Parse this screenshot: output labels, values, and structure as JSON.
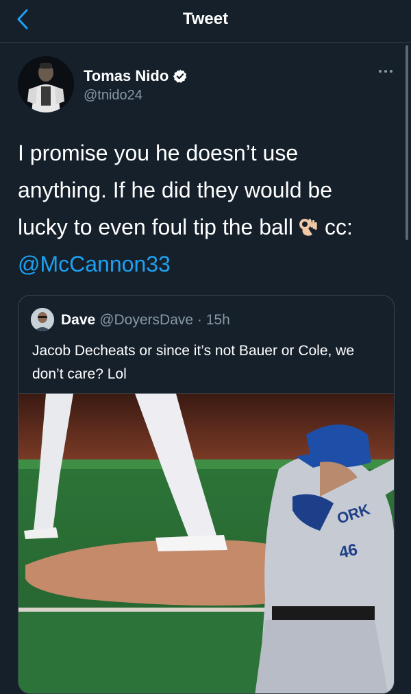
{
  "nav": {
    "title": "Tweet"
  },
  "tweet": {
    "author_name": "Tomas Nido",
    "author_handle": "@tnido24",
    "text_line1": "I promise you he doesn’t use",
    "text_line2": "anything. If he did they would be",
    "text_line3": "lucky to even foul tip the ball",
    "text_cc": "cc:",
    "mention": "@McCannon33"
  },
  "quoted": {
    "name": "Dave",
    "handle": "@DoyersDave",
    "separator": "·",
    "time": "15h",
    "text": "Jacob Decheats or since it’s not Bauer or Cole, we don’t care? Lol"
  },
  "icons": {
    "back": "chevron-left-icon",
    "verified": "verified-badge-icon",
    "more": "more-horizontal-icon",
    "ok_hand": "ok-hand-emoji-icon"
  },
  "colors": {
    "background": "#15202b",
    "accent": "#1da1f2",
    "muted": "#8899a6",
    "border": "#38444d"
  }
}
